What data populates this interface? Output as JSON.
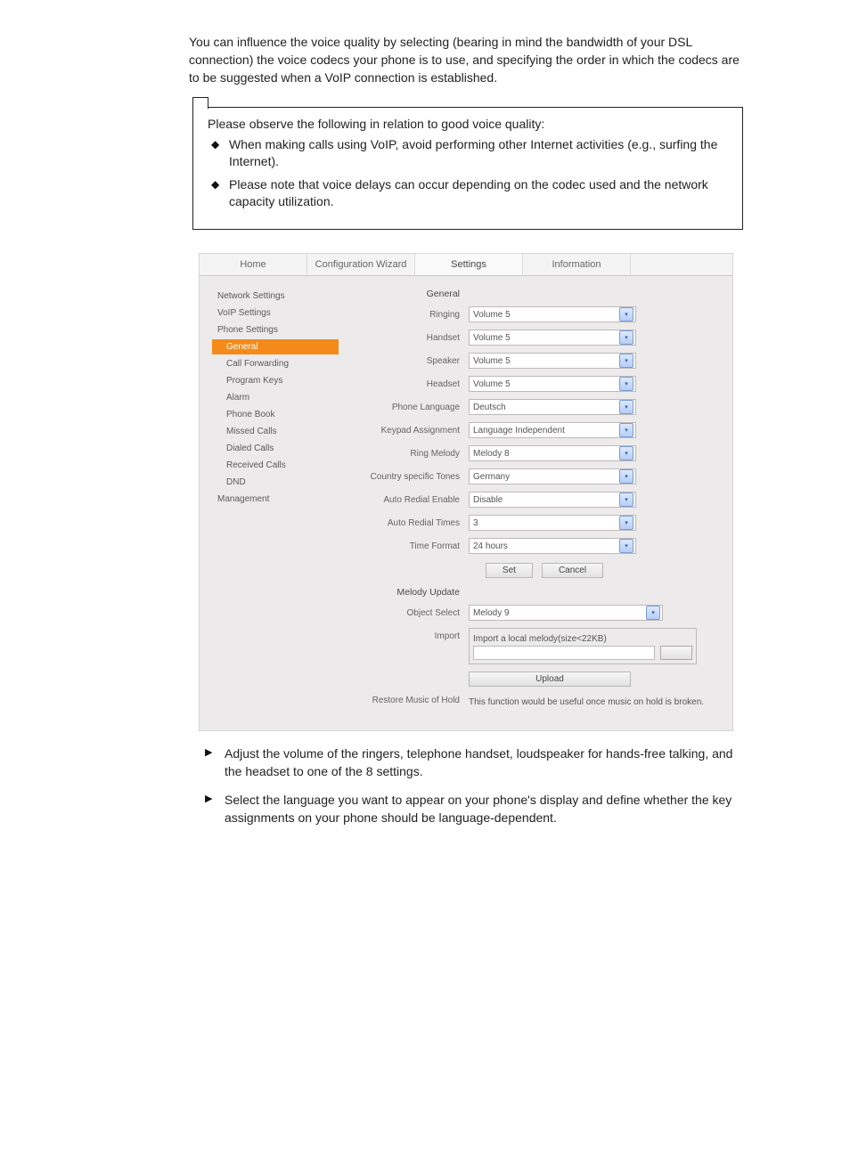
{
  "intro_paragraph": "You can influence the voice quality by selecting (bearing in mind the bandwidth of your DSL connection) the voice codecs your phone is to use, and specifying the order in which the codecs are to be suggested when a VoIP connection is established.",
  "note": {
    "lead": "Please observe the following in relation to good voice quality:",
    "items": [
      "When making calls using VoIP, avoid performing other Internet activities (e.g., surfing the Internet).",
      "Please note that voice delays can occur depending on the codec used and the network capacity utilization."
    ]
  },
  "ui": {
    "tabs": [
      "Home",
      "Configuration Wizard",
      "Settings",
      "Information"
    ],
    "side": {
      "network": "Network Settings",
      "voip": "VoIP Settings",
      "phone": "Phone Settings",
      "items": [
        "General",
        "Call Forwarding",
        "Program Keys",
        "Alarm",
        "Phone Book",
        "Missed Calls",
        "Dialed Calls",
        "Received Calls",
        "DND"
      ],
      "management": "Management"
    },
    "heading_general": "General",
    "rows": [
      {
        "label": "Ringing",
        "value": "Volume 5"
      },
      {
        "label": "Handset",
        "value": "Volume 5"
      },
      {
        "label": "Speaker",
        "value": "Volume 5"
      },
      {
        "label": "Headset",
        "value": "Volume 5"
      },
      {
        "label": "Phone Language",
        "value": "Deutsch"
      },
      {
        "label": "Keypad Assignment",
        "value": "Language Independent"
      },
      {
        "label": "Ring Melody",
        "value": "Melody 8"
      },
      {
        "label": "Country specific Tones",
        "value": "Germany"
      },
      {
        "label": "Auto Redial Enable",
        "value": "Disable"
      },
      {
        "label": "Auto Redial Times",
        "value": "3"
      },
      {
        "label": "Time Format",
        "value": "24 hours"
      }
    ],
    "buttons": {
      "set": "Set",
      "cancel": "Cancel",
      "upload": "Upload"
    },
    "melody_heading": "Melody Update",
    "object_select_label": "Object Select",
    "object_select_value": "Melody 9",
    "import_label": "Import",
    "import_caption": "Import a local melody(size<22KB)",
    "restore_label": "Restore Music of Hold",
    "restore_text": "This function would be useful once music on hold is broken."
  },
  "instructions": [
    "Adjust the volume of the ringers, telephone handset, loudspeaker for hands-free talking, and the headset to one of the 8 settings.",
    "Select the language you want to appear on your phone's display and define whether the key assignments on your phone should be language-dependent."
  ]
}
